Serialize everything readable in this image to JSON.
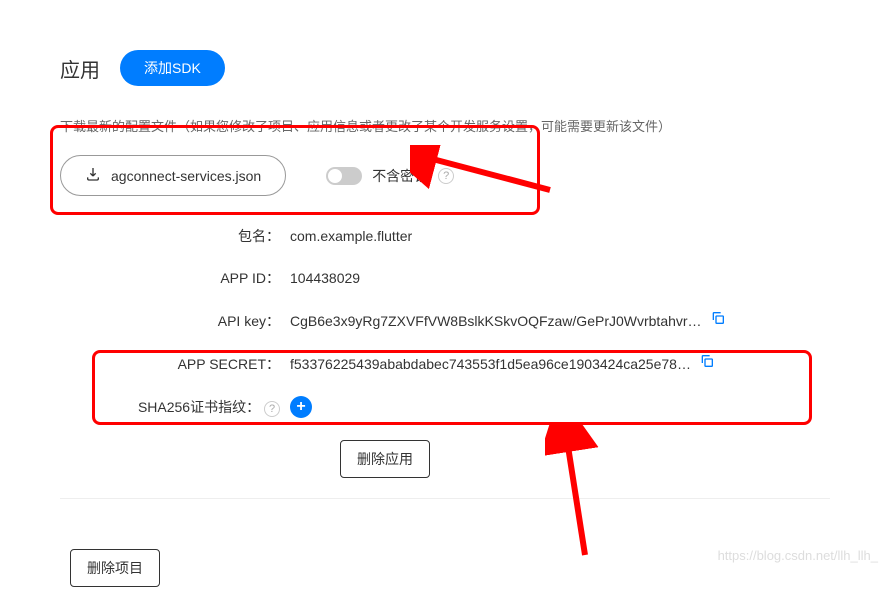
{
  "header": {
    "title": "应用",
    "add_sdk_label": "添加SDK"
  },
  "hint": "下载最新的配置文件（如果您修改了项目、应用信息或者更改了某个开发服务设置，可能需要更新该文件）",
  "download": {
    "filename": "agconnect-services.json"
  },
  "toggle": {
    "label": "不含密钥"
  },
  "fields": {
    "package_label": "包名：",
    "package_value": "com.example.flutter",
    "appid_label": "APP ID：",
    "appid_value": "104438029",
    "apikey_label": "API key：",
    "apikey_value": "CgB6e3x9yRg7ZXVFfVW8BslkKSkvOQFzaw/GePrJ0Wvrbtahvr…",
    "appsecret_label": "APP SECRET：",
    "appsecret_value": "f53376225439ababdabec743553f1d5ea96ce1903424ca25e78…",
    "sha256_label": "SHA256证书指纹："
  },
  "buttons": {
    "delete_app": "删除应用",
    "delete_project": "删除项目"
  },
  "watermark": "https://blog.csdn.net/llh_llh_"
}
